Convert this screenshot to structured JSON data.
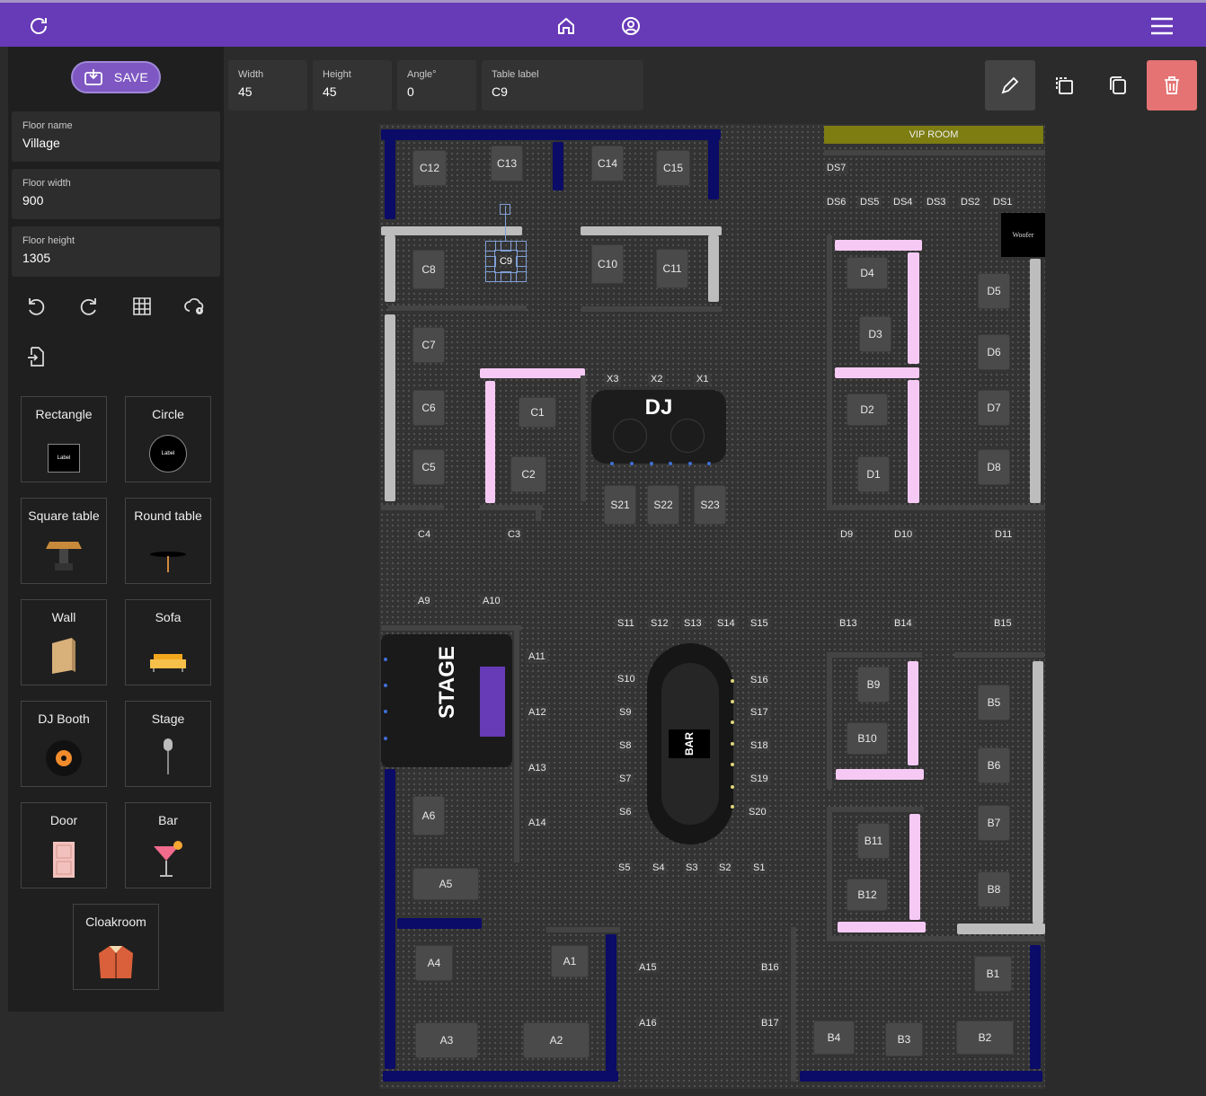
{
  "topbar": {
    "refresh_icon": "refresh-icon",
    "home_icon": "home-icon",
    "account_icon": "account-icon",
    "menu_icon": "menu-icon"
  },
  "sidebar": {
    "save_label": "SAVE",
    "floor_name": {
      "label": "Floor name",
      "value": "Village"
    },
    "floor_width": {
      "label": "Floor width",
      "value": "900"
    },
    "floor_height": {
      "label": "Floor height",
      "value": "1305"
    },
    "palette": [
      {
        "label": "Rectangle",
        "icon": "rectangle-icon"
      },
      {
        "label": "Circle",
        "icon": "circle-icon"
      },
      {
        "label": "Square table",
        "icon": "square-table-icon"
      },
      {
        "label": "Round table",
        "icon": "round-table-icon"
      },
      {
        "label": "Wall",
        "icon": "wall-icon"
      },
      {
        "label": "Sofa",
        "icon": "sofa-icon"
      },
      {
        "label": "DJ Booth",
        "icon": "vinyl-icon"
      },
      {
        "label": "Stage",
        "icon": "microphone-icon"
      },
      {
        "label": "Door",
        "icon": "door-icon"
      },
      {
        "label": "Bar",
        "icon": "cocktail-icon"
      },
      {
        "label": "Cloakroom",
        "icon": "jacket-icon"
      }
    ],
    "shape_sample_label": "Label"
  },
  "properties": {
    "width": {
      "label": "Width",
      "value": "45"
    },
    "height": {
      "label": "Height",
      "value": "45"
    },
    "angle": {
      "label": "Angle°",
      "value": "0"
    },
    "table_label": {
      "label": "Table label",
      "value": "C9"
    }
  },
  "floor": {
    "vip_room": "VIP ROOM",
    "woofer": "Woofer",
    "dj": "DJ",
    "stage": "STAGE",
    "bar": "BAR",
    "selected_table": "C9",
    "tables": [
      {
        "id": "C12",
        "l": "C12"
      },
      {
        "id": "C13",
        "l": "C13"
      },
      {
        "id": "C14",
        "l": "C14"
      },
      {
        "id": "C15",
        "l": "C15"
      },
      {
        "id": "C8",
        "l": "C8"
      },
      {
        "id": "C10",
        "l": "C10"
      },
      {
        "id": "C11",
        "l": "C11"
      },
      {
        "id": "C7",
        "l": "C7"
      },
      {
        "id": "C6",
        "l": "C6"
      },
      {
        "id": "C5",
        "l": "C5"
      },
      {
        "id": "C1",
        "l": "C1"
      },
      {
        "id": "C2",
        "l": "C2"
      },
      {
        "id": "D4",
        "l": "D4"
      },
      {
        "id": "D3",
        "l": "D3"
      },
      {
        "id": "D2",
        "l": "D2"
      },
      {
        "id": "D1",
        "l": "D1"
      },
      {
        "id": "D5",
        "l": "D5"
      },
      {
        "id": "D6",
        "l": "D6"
      },
      {
        "id": "D7",
        "l": "D7"
      },
      {
        "id": "D8",
        "l": "D8"
      },
      {
        "id": "S21",
        "l": "S21"
      },
      {
        "id": "S22",
        "l": "S22"
      },
      {
        "id": "S23",
        "l": "S23"
      },
      {
        "id": "B9",
        "l": "B9"
      },
      {
        "id": "B10",
        "l": "B10"
      },
      {
        "id": "B11",
        "l": "B11"
      },
      {
        "id": "B12",
        "l": "B12"
      },
      {
        "id": "B5",
        "l": "B5"
      },
      {
        "id": "B6",
        "l": "B6"
      },
      {
        "id": "B7",
        "l": "B7"
      },
      {
        "id": "B8",
        "l": "B8"
      },
      {
        "id": "A6",
        "l": "A6"
      },
      {
        "id": "A5",
        "l": "A5"
      },
      {
        "id": "A4",
        "l": "A4"
      },
      {
        "id": "A1",
        "l": "A1"
      },
      {
        "id": "A3",
        "l": "A3"
      },
      {
        "id": "A2",
        "l": "A2"
      },
      {
        "id": "B1",
        "l": "B1"
      },
      {
        "id": "B4",
        "l": "B4"
      },
      {
        "id": "B3",
        "l": "B3"
      },
      {
        "id": "B2",
        "l": "B2"
      }
    ],
    "labels": [
      "DS7",
      "DS6",
      "DS5",
      "DS4",
      "DS3",
      "DS2",
      "DS1",
      "X3",
      "X2",
      "X1",
      "C4",
      "C3",
      "D9",
      "D10",
      "D11",
      "A9",
      "A10",
      "S11",
      "S12",
      "S13",
      "S14",
      "S15",
      "B13",
      "B14",
      "B15",
      "A11",
      "A12",
      "A13",
      "A14",
      "S10",
      "S9",
      "S8",
      "S7",
      "S6",
      "S16",
      "S17",
      "S18",
      "S19",
      "S20",
      "S5",
      "S4",
      "S3",
      "S2",
      "S1",
      "A15",
      "A16",
      "B16",
      "B17"
    ]
  }
}
